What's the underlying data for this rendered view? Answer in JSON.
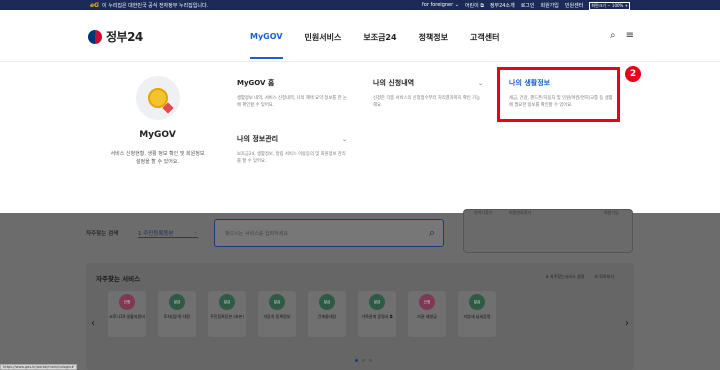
{
  "topbar": {
    "eg_mark": "eG",
    "notice": "이 누리집은 대한민국 공식 전자정부 누리집입니다.",
    "links": [
      "for foreigner ⌄",
      "어린이 ⧉",
      "정부24소개",
      "로그인",
      "회원가입",
      "민원센터",
      "화면크기 − 100% +"
    ]
  },
  "header": {
    "logo_text": "정부24",
    "nav": [
      "MyGOV",
      "민원서비스",
      "보조금24",
      "정책정보",
      "고객센터"
    ],
    "search_icon": "⌕",
    "menu_icon": "≡"
  },
  "mega": {
    "profile": {
      "title": "MyGOV",
      "desc": "서비스 신청현황, 생활 정보 확인 및 회원정보 설정을 할 수 있어요."
    },
    "blocks": [
      {
        "title": "MyGOV 홈",
        "desc": "생활정보 내역, 서비스 신청내역, 나의 혜택 요약 정보를 한 눈에 확인할 수 있어요.",
        "chev": ""
      },
      {
        "title": "나의 신청내역",
        "desc": "신청한 각종 서비스의 신청접수부터 처리결과까지 확인 가능해요.",
        "chev": "⌄"
      },
      {
        "title": "나의 생활정보",
        "desc": "세금, 건강, 핸드폰/자동차 및 민원/여권/면허/교통 등 생활에 필요한 정보를 확인할 수 있어요.",
        "chev": ""
      },
      {
        "title": "나의 정보관리",
        "desc": "보조금24, 생활정보, 알림 서비스 이용동의 및 회원정보 관리를 할 수 있어요.",
        "chev": "⌄"
      }
    ],
    "callout_number": "2"
  },
  "search": {
    "label": "자주찾는 검색",
    "select": "1 주민등록등본",
    "placeholder": "찾으시는 서비스를 입력하세요",
    "login_links": [
      "아이디찾기",
      "비밀번호찾기",
      "회원가입"
    ]
  },
  "frequent": {
    "title": "자주찾는 서비스",
    "tools": [
      "⊕ 자주찾는서비스 설정",
      "☰ 모아보기"
    ],
    "items": [
      {
        "tag": "신청",
        "color": "red",
        "label": "코로나19 생활지원비"
      },
      {
        "tag": "발급",
        "color": "green",
        "label": "토지(임야) 대장"
      },
      {
        "tag": "발급",
        "color": "green",
        "label": "주민등록등본 (초본)"
      },
      {
        "tag": "발급",
        "color": "green",
        "label": "자동차 등록원부"
      },
      {
        "tag": "발급",
        "color": "green",
        "label": "건축물대장"
      },
      {
        "tag": "발급",
        "color": "green",
        "label": "가족관계 증명서 ⧉"
      },
      {
        "tag": "신청",
        "color": "red",
        "label": "여권 재발급"
      },
      {
        "tag": "발급",
        "color": "green",
        "label": "지방세 납세증명"
      }
    ],
    "prev": "‹",
    "next": "›"
  },
  "status_url": "https://www.gov.kr/portal/main/nologin#"
}
